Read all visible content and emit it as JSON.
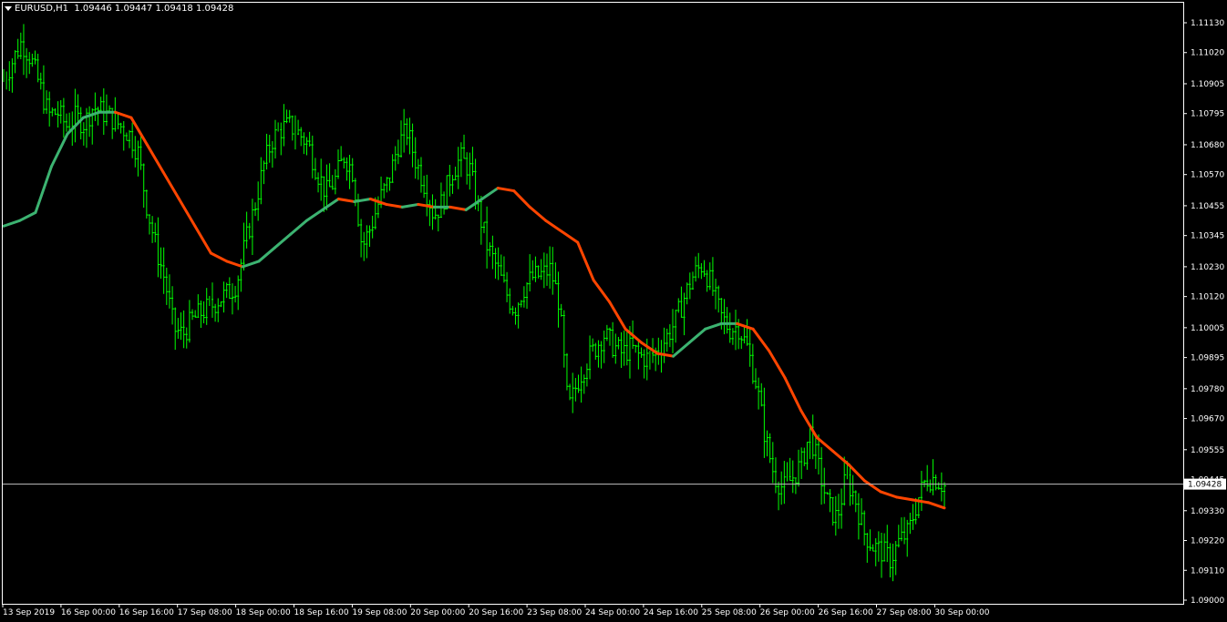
{
  "header": {
    "symbol": "EURUSD,H1",
    "ohlc": "1.09446 1.09447 1.09418 1.09428"
  },
  "colors": {
    "background": "#000000",
    "frame": "#ffffff",
    "candles": "#00ff00",
    "ma_up": "#3cb371",
    "ma_down": "#ff4500",
    "bid_line": "#c0c0c0"
  },
  "chart_data": {
    "type": "line",
    "symbol": "EURUSD",
    "timeframe": "H1",
    "title": "EURUSD,H1",
    "ylim": [
      1.09,
      1.1118
    ],
    "y_ticks": [
      "1.11130",
      "1.11020",
      "1.10905",
      "1.10795",
      "1.10680",
      "1.10570",
      "1.10455",
      "1.10345",
      "1.10230",
      "1.10120",
      "1.10005",
      "1.09895",
      "1.09780",
      "1.09670",
      "1.09555",
      "1.09445",
      "1.09330",
      "1.09220",
      "1.09110",
      "1.09000"
    ],
    "x_ticks": [
      "13 Sep 2019",
      "16 Sep 00:00",
      "16 Sep 16:00",
      "17 Sep 08:00",
      "18 Sep 00:00",
      "18 Sep 16:00",
      "19 Sep 08:00",
      "20 Sep 00:00",
      "20 Sep 16:00",
      "23 Sep 08:00",
      "24 Sep 00:00",
      "24 Sep 16:00",
      "25 Sep 08:00",
      "26 Sep 00:00",
      "26 Sep 16:00",
      "27 Sep 08:00",
      "30 Sep 00:00"
    ],
    "current_price": "1.09428",
    "current_price_value": 1.09428,
    "price_close_series": [
      1.1092,
      1.1099,
      1.1106,
      1.11,
      1.109,
      1.1079,
      1.108,
      1.1075,
      1.1078,
      1.1076,
      1.1082,
      1.108,
      1.1078,
      1.1075,
      1.1072,
      1.1065,
      1.1045,
      1.103,
      1.1018,
      1.1,
      1.0998,
      1.1003,
      1.1006,
      1.1008,
      1.1011,
      1.1013,
      1.1017,
      1.1032,
      1.1045,
      1.106,
      1.107,
      1.1074,
      1.1075,
      1.1072,
      1.1068,
      1.1058,
      1.105,
      1.1055,
      1.1064,
      1.1058,
      1.103,
      1.1038,
      1.1048,
      1.1055,
      1.1068,
      1.1073,
      1.1062,
      1.1053,
      1.1042,
      1.1047,
      1.1058,
      1.1063,
      1.1059,
      1.1044,
      1.103,
      1.1023,
      1.1014,
      1.1007,
      1.1015,
      1.1019,
      1.102,
      1.1022,
      1.101,
      1.097,
      1.098,
      1.0988,
      1.0993,
      1.0998,
      1.0994,
      1.0991,
      1.0993,
      1.099,
      1.0989,
      1.0992,
      1.0997,
      1.1003,
      1.1012,
      1.102,
      1.1024,
      1.1016,
      1.1005,
      1.1,
      1.1001,
      1.0993,
      1.098,
      1.096,
      1.0946,
      1.0941,
      1.0945,
      1.095,
      1.0962,
      1.0948,
      1.0935,
      1.093,
      1.0945,
      1.0938,
      1.0925,
      1.092,
      1.0918,
      1.0915,
      1.0922,
      1.0925,
      1.0937,
      1.0945,
      1.0945,
      1.0942
    ],
    "ma_series": [
      1.1038,
      1.104,
      1.1043,
      1.106,
      1.1072,
      1.1078,
      1.108,
      1.108,
      1.1078,
      1.1068,
      1.1058,
      1.1048,
      1.1038,
      1.1028,
      1.1025,
      1.1023,
      1.1025,
      1.103,
      1.1035,
      1.104,
      1.1044,
      1.1048,
      1.1047,
      1.1048,
      1.1046,
      1.1045,
      1.1046,
      1.1045,
      1.1045,
      1.1044,
      1.1048,
      1.1052,
      1.1051,
      1.1045,
      1.104,
      1.1036,
      1.1032,
      1.1018,
      1.101,
      1.1,
      1.0995,
      1.0991,
      1.099,
      1.0995,
      1.1,
      1.1002,
      1.1002,
      1.1,
      1.0992,
      1.0982,
      1.097,
      1.096,
      1.0955,
      1.095,
      1.0944,
      1.094,
      1.0938,
      1.0937,
      1.0936,
      1.0934
    ]
  }
}
